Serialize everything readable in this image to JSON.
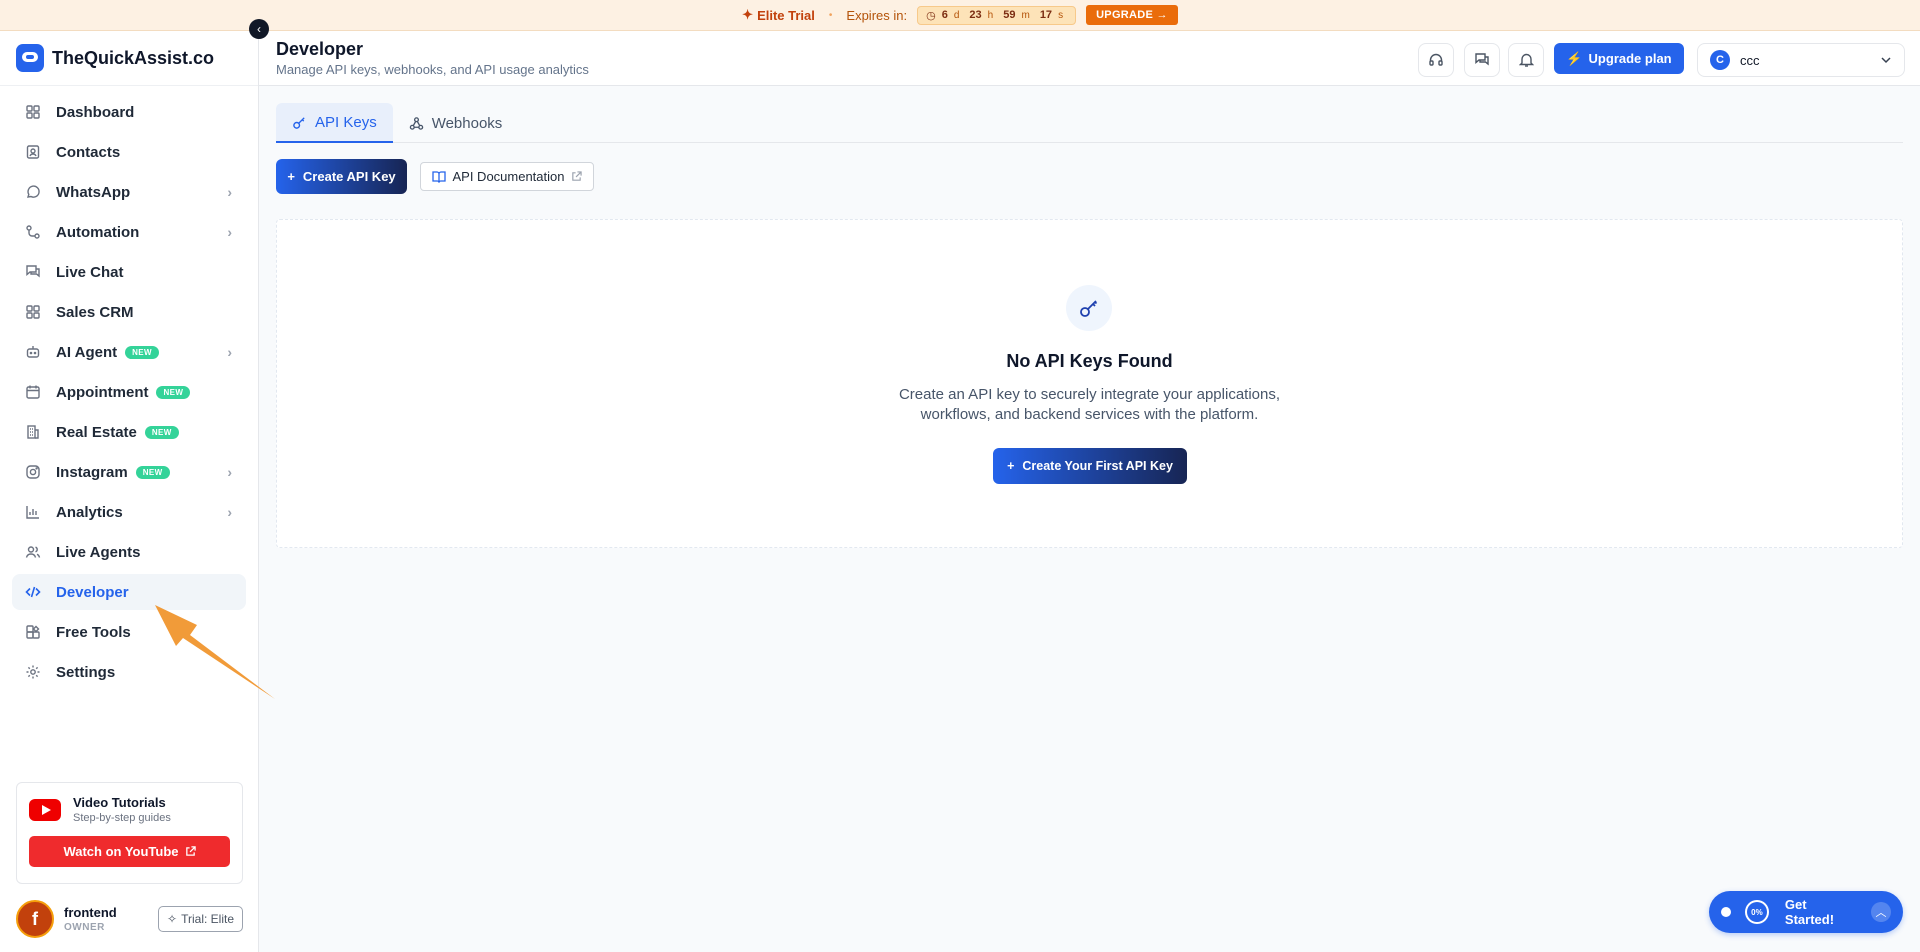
{
  "banner": {
    "trial_name": "Elite Trial",
    "expires_label": "Expires in:",
    "countdown": {
      "days": "6",
      "days_unit": "d",
      "hours": "23",
      "hours_unit": "h",
      "minutes": "59",
      "minutes_unit": "m",
      "seconds": "17",
      "seconds_unit": "s"
    },
    "upgrade_label": "UPGRADE →"
  },
  "brand": {
    "name": "TheQuickAssist.co"
  },
  "header": {
    "title": "Developer",
    "subtitle": "Manage API keys, webhooks, and API usage analytics",
    "upgrade_plan_label": "Upgrade plan",
    "account": {
      "initial": "C",
      "name": "ccc"
    }
  },
  "sidebar": {
    "items": [
      {
        "label": "Dashboard",
        "icon": "dashboard-icon"
      },
      {
        "label": "Contacts",
        "icon": "contacts-icon"
      },
      {
        "label": "WhatsApp",
        "icon": "whatsapp-icon",
        "has_submenu": true
      },
      {
        "label": "Automation",
        "icon": "automation-icon",
        "has_submenu": true
      },
      {
        "label": "Live Chat",
        "icon": "chat-icon"
      },
      {
        "label": "Sales CRM",
        "icon": "crm-icon"
      },
      {
        "label": "AI Agent",
        "icon": "bot-icon",
        "badge": "NEW",
        "has_submenu": true
      },
      {
        "label": "Appointment",
        "icon": "calendar-icon",
        "badge": "NEW"
      },
      {
        "label": "Real Estate",
        "icon": "building-icon",
        "badge": "NEW"
      },
      {
        "label": "Instagram",
        "icon": "instagram-icon",
        "badge": "NEW",
        "has_submenu": true
      },
      {
        "label": "Analytics",
        "icon": "analytics-icon",
        "has_submenu": true
      },
      {
        "label": "Live Agents",
        "icon": "users-icon"
      },
      {
        "label": "Developer",
        "icon": "code-icon",
        "active": true
      },
      {
        "label": "Free Tools",
        "icon": "tools-icon"
      },
      {
        "label": "Settings",
        "icon": "gear-icon"
      }
    ],
    "tutorials": {
      "title": "Video Tutorials",
      "subtitle": "Step-by-step guides",
      "button_label": "Watch on YouTube"
    },
    "user": {
      "initial": "f",
      "name": "frontend",
      "role": "OWNER",
      "plan_chip": "Trial: Elite"
    }
  },
  "tabs": [
    {
      "label": "API Keys",
      "icon": "key-icon",
      "active": true
    },
    {
      "label": "Webhooks",
      "icon": "webhook-icon",
      "active": false
    }
  ],
  "actions": {
    "create_key_label": "Create API Key",
    "docs_label": "API Documentation"
  },
  "empty_state": {
    "title": "No API Keys Found",
    "description_line1": "Create an API key to securely integrate your applications,",
    "description_line2": "workflows, and backend services with the platform.",
    "button_label": "Create Your First API Key"
  },
  "get_started": {
    "percent": "0%",
    "label": "Get Started!"
  },
  "colors": {
    "accent": "#2563eb",
    "trial": "#ea6c0a",
    "youtube": "#ef2b2d",
    "new_badge": "#34d399"
  }
}
